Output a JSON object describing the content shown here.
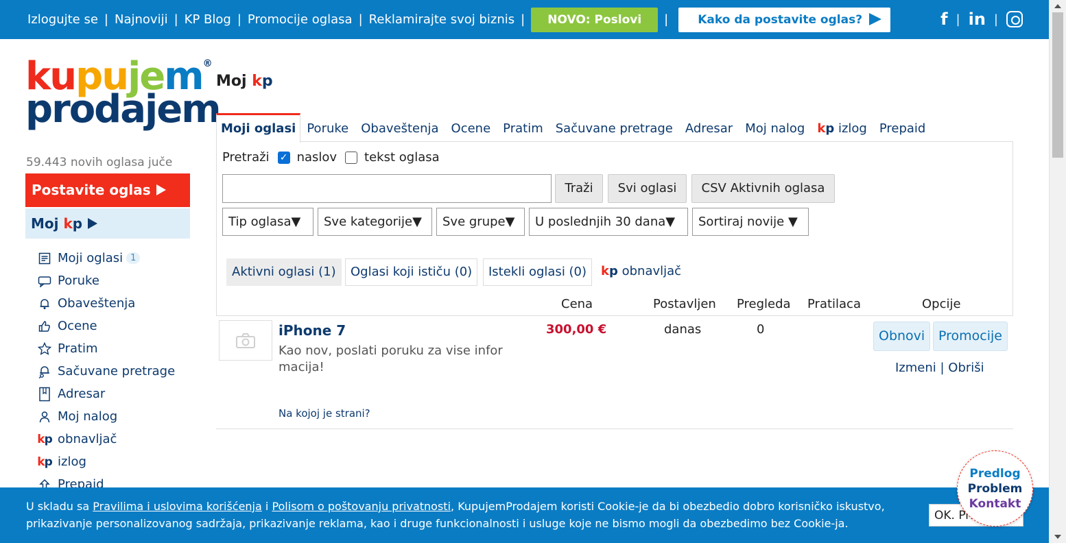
{
  "topbar": {
    "links": [
      "Izlogujte se",
      "Najnoviji",
      "KP Blog",
      "Promocije oglasa",
      "Reklamirajte svoj biznis"
    ],
    "novo_label": "NOVO: Poslovi",
    "kako_label": "Kako da postavite oglas?",
    "social": [
      "facebook",
      "linkedin",
      "instagram"
    ]
  },
  "logo": {
    "line1_parts": [
      "ku",
      "pu",
      "je",
      "m"
    ],
    "line2": "prodajem",
    "reg": "®"
  },
  "sidebar": {
    "stat": "59.443 novih oglasa juče",
    "post_label": "Postavite oglas",
    "mojkp_prefix": "Moj",
    "items": [
      {
        "label": "Moji oglasi",
        "icon": "list-icon",
        "badge": "1"
      },
      {
        "label": "Poruke",
        "icon": "chat-icon"
      },
      {
        "label": "Obaveštenja",
        "icon": "bell-icon"
      },
      {
        "label": "Ocene",
        "icon": "thumbs-up-icon"
      },
      {
        "label": "Pratim",
        "icon": "star-icon"
      },
      {
        "label": "Sačuvane pretrage",
        "icon": "saved-search-icon"
      },
      {
        "label": "Adresar",
        "icon": "address-book-icon"
      },
      {
        "label": "Moj nalog",
        "icon": "user-icon"
      },
      {
        "label": "obnavljač",
        "icon": "kp-icon"
      },
      {
        "label": "izlog",
        "icon": "kp-icon"
      },
      {
        "label": "Prepaid",
        "icon": "prepaid-icon"
      }
    ]
  },
  "main": {
    "title_prefix": "Moj",
    "tabs": [
      "Moji oglasi",
      "Poruke",
      "Obaveštenja",
      "Ocene",
      "Pratim",
      "Sačuvane pretrage",
      "Adresar",
      "Moj nalog",
      "izlog",
      "Prepaid"
    ],
    "search": {
      "label": "Pretraži",
      "opt_title": "naslov",
      "opt_title_checked": true,
      "opt_text": "tekst oglasa",
      "opt_text_checked": false,
      "value": "",
      "btn_search": "Traži",
      "btn_all": "Svi oglasi",
      "btn_csv": "CSV Aktivnih oglasa"
    },
    "filters": [
      "Tip oglasa",
      "Sve kategorije",
      "Sve grupe",
      "U poslednjih 30 dana",
      "Sortiraj novije"
    ],
    "filter_tabs": [
      "Aktivni oglasi (1)",
      "Oglasi koji ističu (0)",
      "Istekli oglasi (0)"
    ],
    "obnavljac_label": "obnavljač",
    "columns": [
      "Cena",
      "Postavljen",
      "Pregleda",
      "Pratilaca",
      "Opcije"
    ],
    "ad": {
      "title": "iPhone 7",
      "description": "Kao nov, poslati poruku za vise infor macija!",
      "price": "300,00 €",
      "posted": "danas",
      "views": "0",
      "followers": "",
      "btn_renew": "Obnovi",
      "btn_promo": "Promocije",
      "edit": "Izmeni",
      "delete": "Obriši",
      "position_link": "Na kojoj je strani?"
    }
  },
  "cookie": {
    "t1": "U skladu sa ",
    "link1": "Pravilima i uslovima korišćenja",
    "t2": " i ",
    "link2": "Polisom o poštovanju privatnosti",
    "t3": ", KupujemProdajem koristi Cookie-je da bi obezbedio dobro korisničko iskustvo,",
    "line2": "prikazivanje personalizovanog sadržaja, prikazivanje reklama, kao i druge funkcionalnosti i usluge koje ne bismo mogli da obezbedimo bez Cookie-ja.",
    "ok_label": "OK. Prihvatam"
  },
  "feedback": {
    "l1": "Predlog",
    "l2": "Problem",
    "l3": "Kontakt"
  },
  "colors": {
    "brand_blue": "#0a7cc4",
    "brand_red": "#ef2b1c",
    "navy": "#0d3a6e",
    "green": "#8cc63f",
    "price_red": "#c8102e"
  }
}
